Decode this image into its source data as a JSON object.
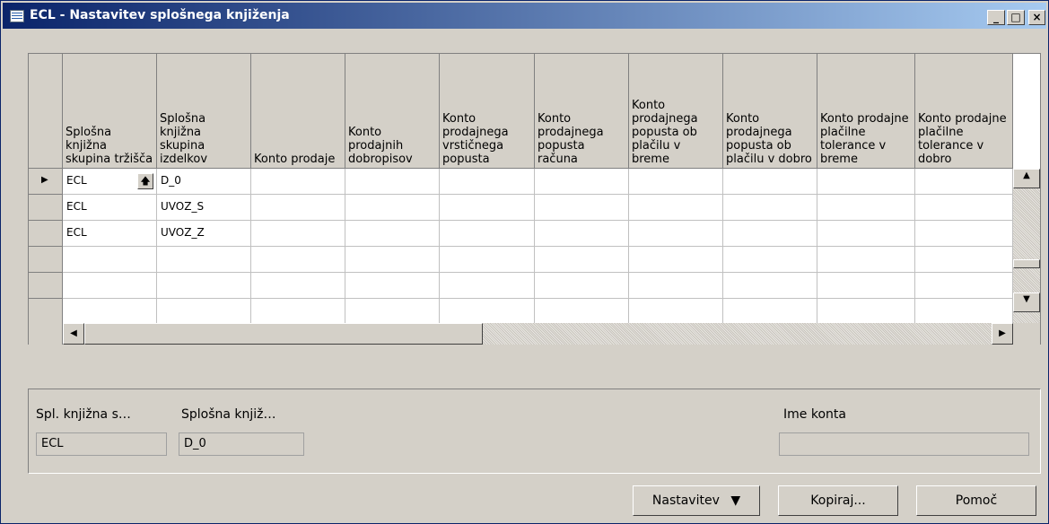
{
  "window": {
    "title": "ECL - Nastavitev splošnega knjiženja",
    "controls": [
      "minimize",
      "maximize",
      "close"
    ],
    "minimize_glyph": "_",
    "maximize_glyph": "□",
    "close_glyph": "×"
  },
  "grid": {
    "columns": [
      "Splošna knjižna skupina tržišča",
      "Splošna knjižna skupina izdelkov",
      "Konto prodaje",
      "Konto prodajnih dobropisov",
      "Konto prodajnega vrstičnega popusta",
      "Konto prodajnega popusta računa",
      "Konto prodajnega popusta ob plačilu v breme",
      "Konto prodajnega popusta ob plačilu v dobro",
      "Konto prodajne plačilne tolerance v breme",
      "Konto prodajne plačilne tolerance v dobro"
    ],
    "rows": [
      [
        "ECL",
        "D_0",
        "",
        "",
        "",
        "",
        "",
        "",
        "",
        ""
      ],
      [
        "ECL",
        "UVOZ_S",
        "",
        "",
        "",
        "",
        "",
        "",
        "",
        ""
      ],
      [
        "ECL",
        "UVOZ_Z",
        "",
        "",
        "",
        "",
        "",
        "",
        "",
        ""
      ],
      [
        "",
        "",
        "",
        "",
        "",
        "",
        "",
        "",
        "",
        ""
      ],
      [
        "",
        "",
        "",
        "",
        "",
        "",
        "",
        "",
        "",
        ""
      ],
      [
        "",
        "",
        "",
        "",
        "",
        "",
        "",
        "",
        "",
        ""
      ]
    ],
    "current_row_marker": "▶",
    "lookup_glyph": "🡅"
  },
  "details": {
    "field1_label": "Spl. knjižna s…",
    "field1_value": "ECL",
    "field2_label": "Splošna knjiž…",
    "field2_value": "D_0",
    "field3_label": "Ime konta",
    "field3_value": ""
  },
  "buttons": {
    "setup_label": "Nastavitev",
    "setup_arrow": "▼",
    "copy_label": "Kopiraj...",
    "help_label": "Pomoč"
  },
  "icons": {
    "title_icon": "table-form-icon",
    "scroll_up": "scroll-up-arrow-icon",
    "scroll_down": "scroll-down-arrow-icon",
    "scroll_left": "scroll-left-arrow-icon",
    "scroll_right": "scroll-right-arrow-icon"
  },
  "colors": {
    "titlebar_start": "#0a246a",
    "titlebar_end": "#a6caf0",
    "face": "#d4d0c8"
  }
}
